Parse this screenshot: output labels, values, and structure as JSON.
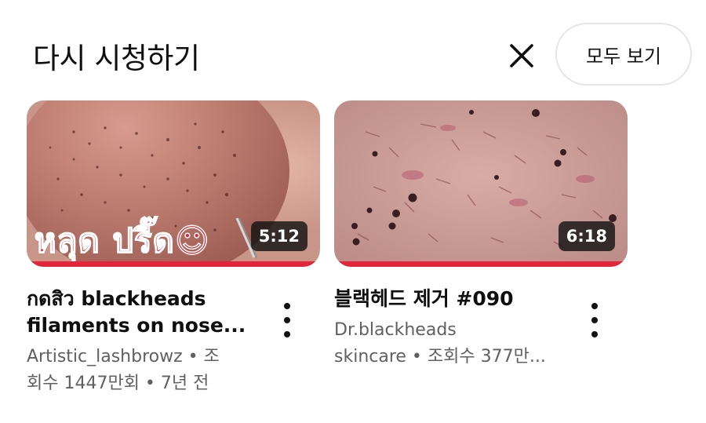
{
  "shelf": {
    "title": "다시 시청하기",
    "view_all_label": "모두 보기",
    "close_icon": "close-icon"
  },
  "videos": [
    {
      "thumbnail_overlay_text": "หลุด ปรี๊ด☺",
      "duration": "5:12",
      "title_line1": "กดสิว blackheads",
      "title_line2": "filaments on nose...",
      "meta_line1": "Artistic_lashbrowz • 조",
      "meta_line2": "회수 1447만회 • 7년 전",
      "watched_fraction": 1.0,
      "menu_icon": "more-vert-icon"
    },
    {
      "duration": "6:18",
      "title_line1": "블랙헤드 제거 #090",
      "meta_line1": "Dr.blackheads",
      "meta_line2": "skincare • 조회수 377만...",
      "watched_fraction": 1.0,
      "menu_icon": "more-vert-icon"
    }
  ],
  "colors": {
    "progress": "#e5243b",
    "text_primary": "#0f0f0f",
    "text_secondary": "#606060"
  }
}
